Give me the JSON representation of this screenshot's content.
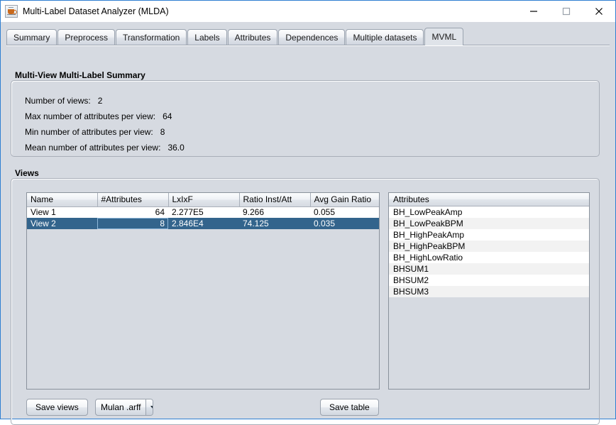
{
  "window": {
    "title": "Multi-Label Dataset Analyzer (MLDA)",
    "icon": "java-cup-icon",
    "accent_border": "#2f7fd1",
    "panel_bg": "#d6dae1",
    "selection_color": "#33648c",
    "controls": {
      "minimize": "minimize-icon",
      "maximize": "maximize-icon",
      "close": "close-icon"
    }
  },
  "tabs": [
    {
      "label": "Summary",
      "active": false
    },
    {
      "label": "Preprocess",
      "active": false
    },
    {
      "label": "Transformation",
      "active": false
    },
    {
      "label": "Labels",
      "active": false
    },
    {
      "label": "Attributes",
      "active": false
    },
    {
      "label": "Dependences",
      "active": false
    },
    {
      "label": "Multiple datasets",
      "active": false
    },
    {
      "label": "MVML",
      "active": true
    }
  ],
  "summary": {
    "group_title": "Multi-View Multi-Label Summary",
    "rows": [
      {
        "label": "Number of views:",
        "value": "2"
      },
      {
        "label": "Max number of attributes per view:",
        "value": "64"
      },
      {
        "label": "Min number of attributes per view:",
        "value": "8"
      },
      {
        "label": "Mean number of attributes per view:",
        "value": "36.0"
      }
    ]
  },
  "views": {
    "group_title": "Views",
    "table": {
      "columns": [
        "Name",
        "#Attributes",
        "LxIxF",
        "Ratio Inst/Att",
        "Avg Gain Ratio"
      ],
      "rows": [
        {
          "name": "View 1",
          "attributes": "64",
          "lxixf": "2.277E5",
          "ratio_inst_att": "9.266",
          "avg_gain_ratio": "0.055",
          "selected": false
        },
        {
          "name": "View 2",
          "attributes": "8",
          "lxixf": "2.846E4",
          "ratio_inst_att": "74.125",
          "avg_gain_ratio": "0.035",
          "selected": true
        }
      ]
    },
    "attributes_list": {
      "header": "Attributes",
      "items": [
        "BH_LowPeakAmp",
        "BH_LowPeakBPM",
        "BH_HighPeakAmp",
        "BH_HighPeakBPM",
        "BH_HighLowRatio",
        "BHSUM1",
        "BHSUM2",
        "BHSUM3"
      ]
    },
    "actions": {
      "save_views": "Save views",
      "format_selected": "Mulan .arff",
      "save_table": "Save table"
    }
  }
}
